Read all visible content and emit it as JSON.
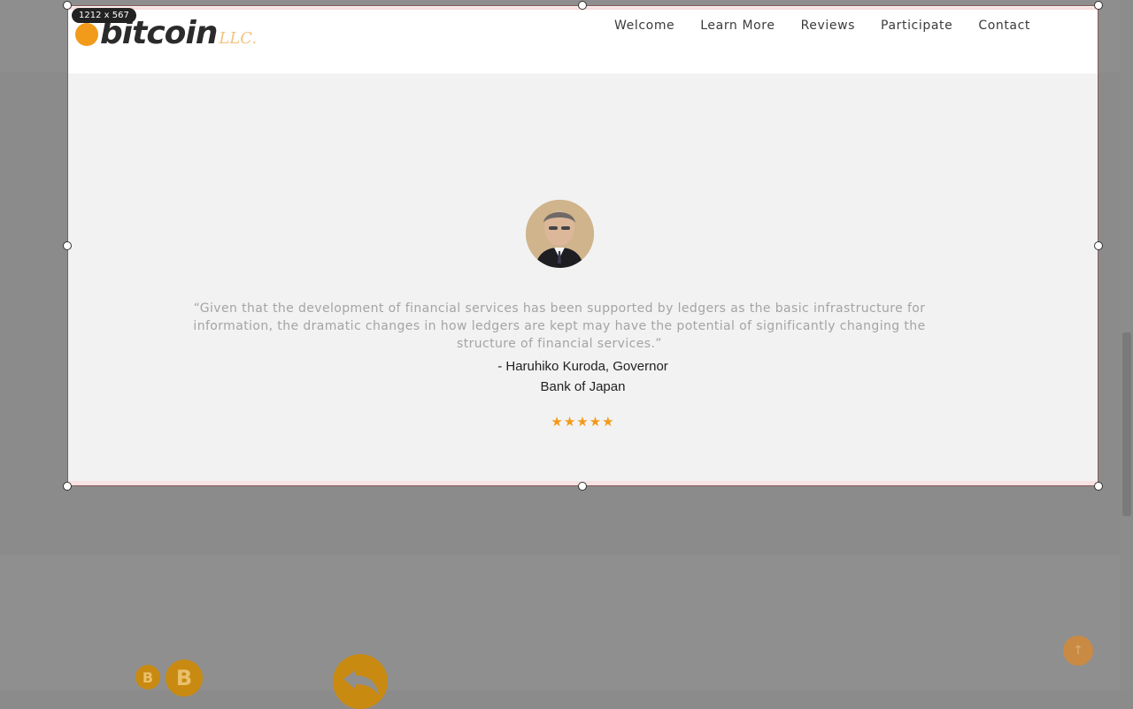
{
  "overlay": {
    "dimension_badge": "1212 x 567"
  },
  "logo": {
    "text": "bitcoin",
    "suffix": "LLC."
  },
  "nav": {
    "items": [
      "Welcome",
      "Learn More",
      "Reviews",
      "Participate",
      "Contact"
    ]
  },
  "testimonial": {
    "quote": "“Given that the development of financial services has been supported by ledgers as the basic infrastructure for information, the dramatic changes in how ledgers are kept may have the potential of significantly changing the structure of financial services.”",
    "author_name": "- Haruhiko Kuroda, Governor",
    "author_org": "Bank of Japan",
    "stars": "★★★★★"
  },
  "footer": {
    "coin_small": "B",
    "coin_big": "B",
    "totop_arrow": "↑"
  },
  "colors": {
    "accent": "#f29a1a",
    "text_dark": "#222222",
    "quote_grey": "#a4a4a4",
    "panel_bg": "#f2f2f2",
    "dim_bg": "#8b8b8b"
  },
  "icons": [
    "bitcoin-coin-icon",
    "return-arrow-icon",
    "scroll-to-top-icon",
    "avatar-photo"
  ]
}
